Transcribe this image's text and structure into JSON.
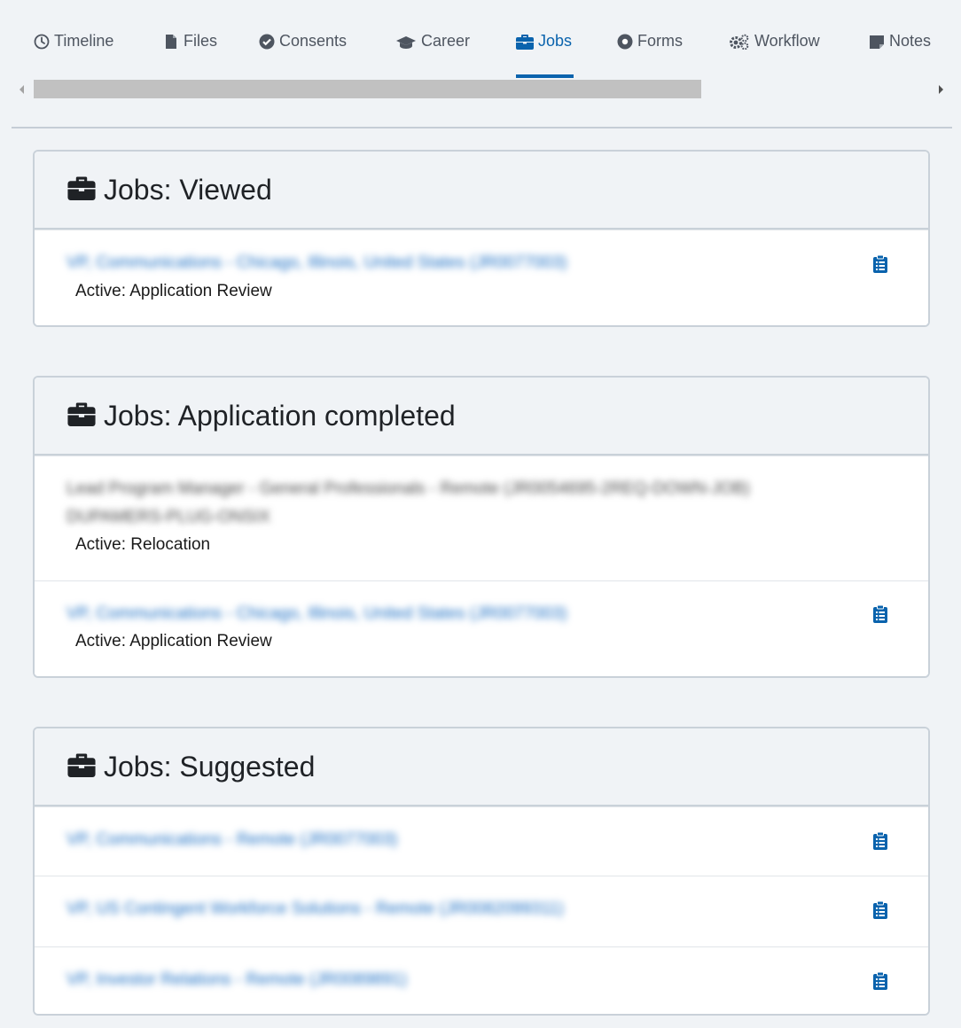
{
  "tabs": [
    {
      "label": "Timeline",
      "icon": "clock-icon",
      "active": false
    },
    {
      "label": "Files",
      "icon": "file-icon",
      "active": false
    },
    {
      "label": "Consents",
      "icon": "check-circle-icon",
      "active": false
    },
    {
      "label": "Career",
      "icon": "graduation-cap-icon",
      "active": false
    },
    {
      "label": "Jobs",
      "icon": "briefcase-icon",
      "active": true
    },
    {
      "label": "Forms",
      "icon": "dot-circle-icon",
      "active": false
    },
    {
      "label": "Workflow",
      "icon": "cogs-icon",
      "active": false
    },
    {
      "label": "Notes",
      "icon": "sticky-note-icon",
      "active": false
    }
  ],
  "colors": {
    "accent": "#0a63ad",
    "link": "#1c6fc4",
    "background": "#f0f3f6",
    "border": "#c9d1d9"
  },
  "sections": [
    {
      "title": "Jobs: Viewed",
      "icon": "briefcase-icon",
      "rows": [
        {
          "job": "VP, Communications - Chicago, Illinois, United States (JR0077003)",
          "status": "Active: Application Review",
          "clipboard": true
        }
      ]
    },
    {
      "title": "Jobs: Application completed",
      "icon": "briefcase-icon",
      "rows": [
        {
          "job": "Lead Program Manager - General Professionals - Remote (JR0054695-2REQ-DOWN-JOB)",
          "job_line2": "DUPAMERS-PLUG-ONSIX",
          "status": "Active: Relocation",
          "clipboard": false
        },
        {
          "job": "VP, Communications - Chicago, Illinois, United States (JR0077003)",
          "status": "Active: Application Review",
          "clipboard": true
        }
      ]
    },
    {
      "title": "Jobs: Suggested",
      "icon": "briefcase-icon",
      "rows": [
        {
          "job": "VP, Communications - Remote (JR0077003)",
          "clipboard": true
        },
        {
          "job": "VP, US Contingent Workforce Solutions - Remote (JR0082099311)",
          "clipboard": true
        },
        {
          "job": "VP, Investor Relations - Remote (JR0089891)",
          "clipboard": true
        }
      ]
    }
  ]
}
